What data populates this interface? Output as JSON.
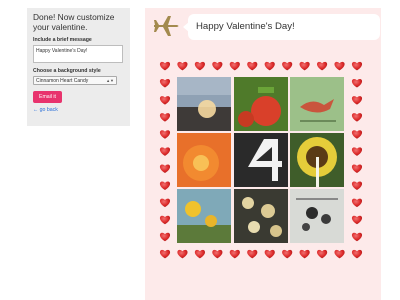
{
  "sidebar": {
    "heading": "Done! Now customize your valentine.",
    "message_label": "Include a brief message",
    "message_value": "Happy Valentine's Day!",
    "style_label": "Choose a background style",
    "style_value": "Cinnamon Heart Candy",
    "email_label": "Email it",
    "back_link": "← go back"
  },
  "card": {
    "greeting": "Happy Valentine's Day!",
    "icon": "airplane-icon",
    "border": "heart-icon",
    "photos": [
      "sunset-photo",
      "strawberry-photo",
      "bird-art-photo",
      "orange-flower-photo",
      "number-four-photo",
      "sunflower-photo",
      "yellow-flowers-photo",
      "flower-blossoms-photo",
      "abstract-photo"
    ]
  },
  "colors": {
    "panel": "#fdeaea",
    "sidebar": "#ececec",
    "button": "#e8336d",
    "link": "#2a6fd8",
    "heart": "#dd2b2b"
  }
}
